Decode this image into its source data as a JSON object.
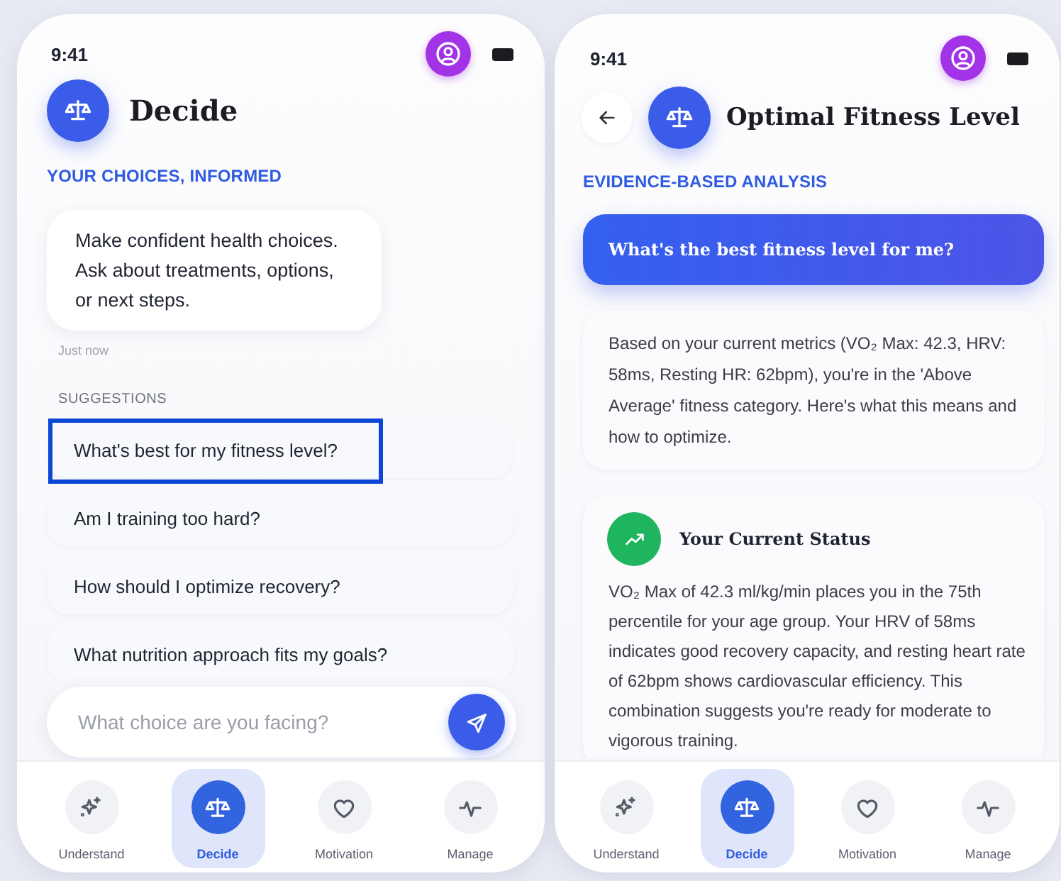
{
  "screens": [
    {
      "kind": "home",
      "status_time": "9:41",
      "title": "Decide",
      "subtitle": "YOUR CHOICES, INFORMED",
      "message": {
        "text": "Make confident health choices. Ask about treatments, options, or next steps.",
        "time": "Just now"
      },
      "suggestions_heading": "SUGGESTIONS",
      "suggestions": [
        {
          "text": "What's best for my fitness level?",
          "selected": true
        },
        {
          "text": "Am I training too hard?",
          "selected": false
        },
        {
          "text": "How should I optimize recovery?",
          "selected": false
        },
        {
          "text": "What nutrition approach fits my goals?",
          "selected": false
        }
      ],
      "input": {
        "placeholder": "What choice are you facing?"
      },
      "nav": [
        {
          "label": "Understand",
          "selected": false
        },
        {
          "label": "Decide",
          "selected": true
        },
        {
          "label": "Motivation",
          "selected": false
        },
        {
          "label": "Manage",
          "selected": false
        }
      ]
    },
    {
      "kind": "detail",
      "status_time": "9:41",
      "title": "Optimal Fitness Level",
      "subtitle": "EVIDENCE-BASED ANALYSIS",
      "question": "What's the best fitness level for me?",
      "answer": "Based on your current metrics (VO₂ Max: 42.3, HRV: 58ms, Resting HR: 62bpm), you're in the 'Above Average' fitness category. Here's what this means and how to optimize.",
      "sections": [
        {
          "title": "Your Current Status",
          "body": "VO₂ Max of 42.3 ml/kg/min places you in the 75th percentile for your age group. Your HRV of 58ms indicates good recovery capacity, and resting heart rate of 62bpm shows cardiovascular efficiency. This combination suggests you're ready for moderate to vigorous training."
        }
      ],
      "nav": [
        {
          "label": "Understand",
          "selected": false
        },
        {
          "label": "Decide",
          "selected": true
        },
        {
          "label": "Motivation",
          "selected": false
        },
        {
          "label": "Manage",
          "selected": false
        }
      ]
    }
  ]
}
